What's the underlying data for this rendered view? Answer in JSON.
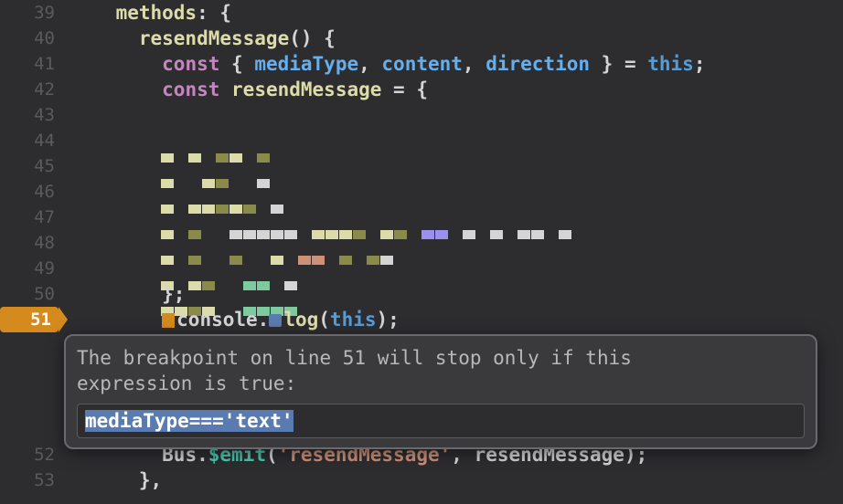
{
  "gutter": {
    "lines": [
      "39",
      "40",
      "41",
      "42",
      "43",
      "44",
      "45",
      "46",
      "47",
      "48",
      "49",
      "50",
      "51",
      "52",
      "53"
    ]
  },
  "code": {
    "l39": {
      "indent2": "    ",
      "methods": "methods",
      "colon_brace": ": {"
    },
    "l40": {
      "indent3": "      ",
      "resend": "resendMessage",
      "call": "() {"
    },
    "l41": {
      "indent4": "        ",
      "const": "const",
      "ob": " { ",
      "mt": "mediaType",
      "c1": ", ",
      "ct": "content",
      "c2": ", ",
      "dir": "direction",
      "cb": " } = ",
      "this": "this",
      "semi": ";"
    },
    "l42": {
      "indent4": "        ",
      "const": "const",
      "sp": " ",
      "rm": "resendMessage",
      "eq": " = {"
    },
    "l50": {
      "indent4": "        ",
      "close": "};"
    },
    "l51": {
      "indent4": "        ",
      "console": "console",
      "dot": ".",
      "log": "log",
      "op": "(",
      "this": "this",
      "cp": ");"
    },
    "l52": {
      "indent4": "        ",
      "bus": "Bus",
      "dot": ".",
      "emit": "$emit",
      "op": "(",
      "str": "'resendMessage'",
      "c": ", ",
      "rm": "resendMessage",
      "cp": ");"
    },
    "l53": {
      "indent3": "      ",
      "close": "},"
    }
  },
  "popup": {
    "text": "The breakpoint on line 51 will stop only if this\nexpression is true:",
    "expression": "mediaType==='text'"
  },
  "breakpoint": {
    "line": "51"
  }
}
